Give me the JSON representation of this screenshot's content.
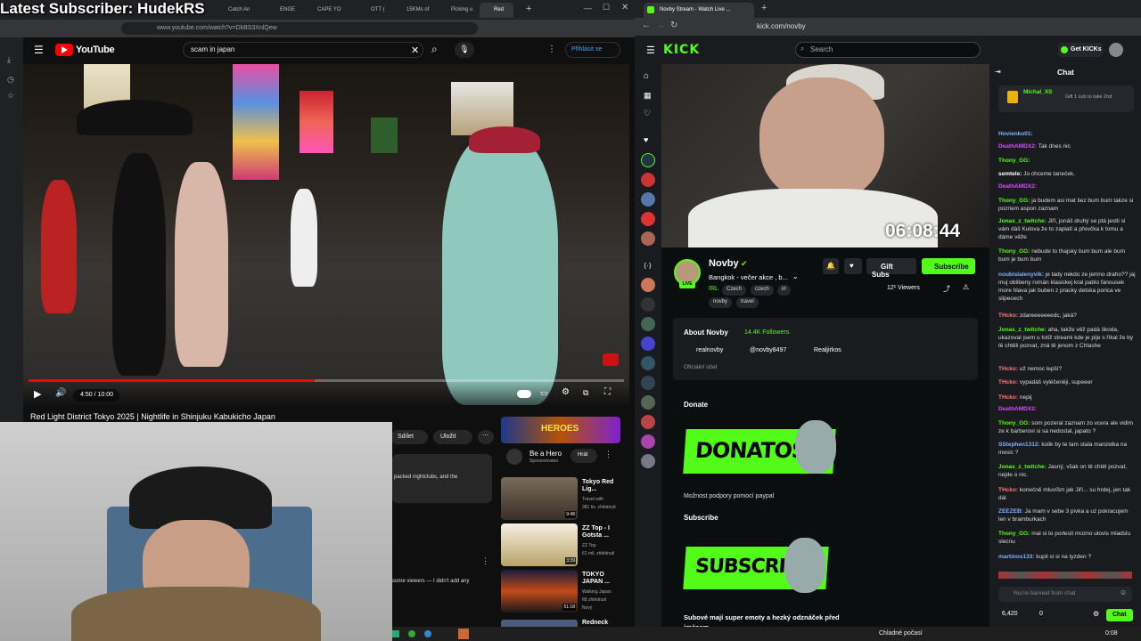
{
  "overlay": {
    "latest_subscriber": "Latest Subscriber: HudekRS"
  },
  "left_browser": {
    "tabs": [
      "Catch An",
      "ENGE",
      "CAPE YO",
      "OTT (",
      "15KMs of",
      "Picking u",
      "Red"
    ],
    "url": "www.youtube.com/watch?v=DkBS3XnlQew",
    "youtube": {
      "search_value": "scam in japan",
      "signin": "Přihlásit se",
      "time": "4:50 / 10:00",
      "progress": 0.48,
      "video_title": "Red Light District Tokyo 2025 | Nightlife in Shinjuku Kabukicho Japan",
      "share": "Sdílet",
      "save": "Uložit",
      "description": "packed nightclubs, and the",
      "comment_snippet": "some viewers — I didn't add any",
      "ad": {
        "title": "Be a Hero",
        "sub": "Sponzorováno",
        "play": "Hrát",
        "brand": "HEROES"
      },
      "recommendations": [
        {
          "title": "Tokyo Red Lig...",
          "channel": "Travel with",
          "meta": "381 tis. zhlédnutí",
          "duration": "9:48"
        },
        {
          "title": "ZZ Top - I Gotsta ...",
          "channel": "ZZ Top",
          "meta": "61 mil. zhlédnutí",
          "duration": "3:39"
        },
        {
          "title": "TOKYO JAPAN ...",
          "channel": "Walking Japan",
          "meta": "68 zhlédnutí",
          "duration": "51:18",
          "badge": "Nový"
        },
        {
          "title": "Redneck",
          "channel": "",
          "meta": "",
          "duration": ""
        }
      ]
    }
  },
  "right_browser": {
    "tab": "Novby Stream - Watch Live ...",
    "url": "kick.com/novby",
    "kick": {
      "logo": "KICK",
      "search_placeholder": "Search",
      "get_kicks": "Get KICKs",
      "stream_timer": "06:08:44",
      "channel_name": "Novby",
      "stream_title": "Bangkok - večer akce , b...",
      "category": "IRL",
      "tags": [
        "Czech",
        "czech",
        "irl",
        "novby",
        "travel"
      ],
      "viewers": "12¹ Viewers",
      "gift_subs": "Gift Subs",
      "subscribe": "Subscribe",
      "about_title": "About Novby",
      "followers": "14.4K Followers",
      "socials": [
        "realnovby",
        "@novby8497",
        "Realjirkos"
      ],
      "official_account": "Oficiální účet",
      "donate_heading": "Donate",
      "donate_panel": "DONATOSS",
      "donate_desc": "Možnost podpory pomocí paypal",
      "subscribe_heading": "Subscribe",
      "subscribe_panel": "SUBSCRIBE",
      "subscribe_desc": "Subové mají super emoty a hezký odznáček před jménem"
    },
    "chat": {
      "title": "Chat",
      "pinned_user": "Michal_XS",
      "pinned_text": "Gift 1 sub to take 2nd",
      "messages": [
        {
          "user": "Hovienko01:",
          "text": "",
          "color": "#7fb3ff"
        },
        {
          "user": "DeathAMDX2:",
          "text": "Tak dnes nic",
          "color": "#d64dff"
        },
        {
          "user": "Thony_GG:",
          "text": "",
          "color": "#53fc18"
        },
        {
          "user": "semtele:",
          "text": "Jo chceme taneček.",
          "color": "#ffffff"
        },
        {
          "user": "DeathAMDX2:",
          "text": "",
          "color": "#d64dff"
        },
        {
          "user": "Thony_GG:",
          "text": "ja budem asi mat tiez bum bum takze si pozriem aspon zaznam",
          "color": "#53fc18"
        },
        {
          "user": "Jonas_z_twitche:",
          "text": "Jiří, jonáš druhý se ptá jestli si vám dáš Kulova že to zaplatí a převčka k tomu a dáme věže",
          "color": "#53fc18"
        },
        {
          "user": "Thony_GG:",
          "text": "nebude to thajsky bum bum ale bum bum je bum bum",
          "color": "#53fc18"
        },
        {
          "user": "noubislalenyvik:",
          "text": "je tady nekdo ze jemno draho?? jaj muj oblibeny román klasickej kral pablo fanousek more hlava jak buben z pracky detska porica ve slipecech",
          "color": "#7fb3ff"
        },
        {
          "user": "THcko:",
          "text": "zdareeeeeeedc, jaká?",
          "color": "#ff7a7a"
        },
        {
          "user": "Jonas_z_twitche:",
          "text": "aha, takže věž padá škoda, ukazoval jsem u totiž streami kde je pije s říkal že by tě chtěli pozvat, zná tě jenom z Chlashe",
          "color": "#53fc18"
        },
        {
          "user": "THcko:",
          "text": "už nemoc lepší?",
          "color": "#ff7a7a"
        },
        {
          "user": "THcko:",
          "text": "vypadáš vyléčeněji, supeeer",
          "color": "#ff7a7a"
        },
        {
          "user": "THcko:",
          "text": "nepij",
          "color": "#ff7a7a"
        },
        {
          "user": "DeathAMDX2:",
          "text": "",
          "color": "#d64dff"
        },
        {
          "user": "Thony_GG:",
          "text": "som pozeral zaznam zo vcera ale vidim ze k barberovi si sa nedostal, japato ?",
          "color": "#53fc18"
        },
        {
          "user": "SStephen1312:",
          "text": "kolik by te tam stala manzelka na mesic ?",
          "color": "#7fb3ff"
        },
        {
          "user": "Jonas_z_twitche:",
          "text": "Jasný, však on tě chtěl pozvat, nejde o nic.",
          "color": "#53fc18"
        },
        {
          "user": "THcko:",
          "text": "konečně mluvíšm jak Jiří... su hrdej, jen tak dál",
          "color": "#ff7a7a"
        },
        {
          "user": "ZEEZEB:",
          "text": "Ja mam v sebe 3 pivka a uz pokracujem len v bramburkach",
          "color": "#7fb3ff"
        },
        {
          "user": "Thony_GG:",
          "text": "mal si to porlesit mozno ulovis mladslu slecnu",
          "color": "#53fc18"
        },
        {
          "user": "martinos133:",
          "text": "kupil si si na tyzden ?",
          "color": "#7fb3ff"
        }
      ],
      "banned_placeholder": "You're banned from chat",
      "points": "6,420",
      "zero": "0",
      "chat_button": "Chat"
    }
  },
  "taskbar": {
    "weather": "Chladné počasí",
    "time": "0:08"
  }
}
